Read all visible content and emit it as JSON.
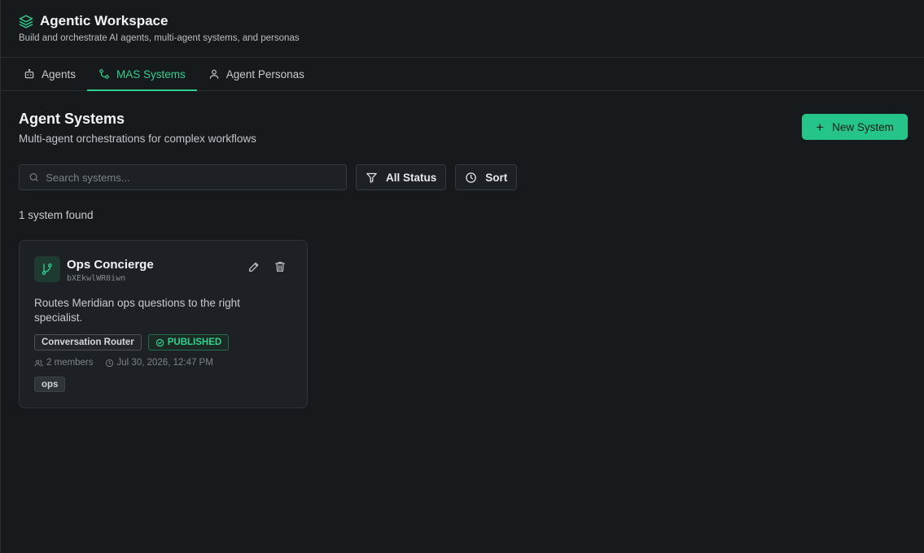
{
  "header": {
    "title": "Agentic Workspace",
    "subtitle": "Build and orchestrate AI agents, multi-agent systems, and personas",
    "icon": "layers-icon"
  },
  "tabs": [
    {
      "label": "Agents",
      "icon": "robot-icon",
      "active": false
    },
    {
      "label": "MAS Systems",
      "icon": "workflow-icon",
      "active": true
    },
    {
      "label": "Agent Personas",
      "icon": "user-icon",
      "active": false
    }
  ],
  "main": {
    "title": "Agent Systems",
    "subtitle": "Multi-agent orchestrations for complex workflows",
    "new_button": "New System",
    "search_placeholder": "Search systems...",
    "status_filter": "All Status",
    "sort_label": "Sort",
    "result_count": "1 system found"
  },
  "systems": [
    {
      "name": "Ops Concierge",
      "id": "bXEkwlWR0iwn",
      "description": "Routes Meridian ops questions to the right specialist.",
      "type": "Conversation Router",
      "status": "PUBLISHED",
      "members": "2 members",
      "updated": "Jul 30, 2026, 12:47 PM",
      "tags": [
        "ops"
      ]
    }
  ],
  "colors": {
    "accent": "#24c48a",
    "background": "#171a1d",
    "card": "#1d2125",
    "published": "#2fd38f"
  }
}
